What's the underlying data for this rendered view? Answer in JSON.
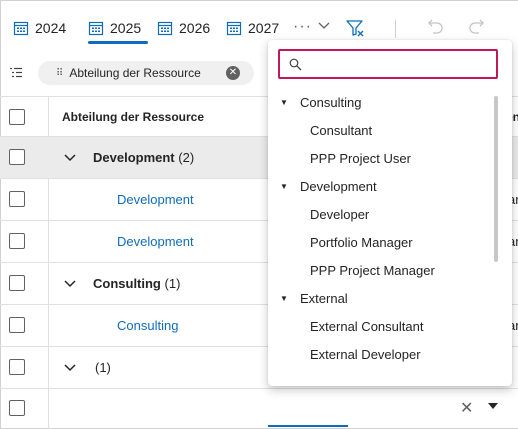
{
  "toolbar": {
    "years": [
      "2024",
      "2025",
      "2026",
      "2027"
    ],
    "active_year": "2025",
    "more_label": "···"
  },
  "groupby": {
    "chip_label": "Abteilung der Ressource",
    "remove_glyph": "✕"
  },
  "grid": {
    "column_header": "Abteilung der Ressource",
    "truncated_header": "en",
    "groups": [
      {
        "label": "Development",
        "count": "(2)",
        "items": [
          "Development",
          "Development"
        ]
      },
      {
        "label": "Consulting",
        "count": "(1)",
        "items": [
          "Consulting"
        ]
      },
      {
        "label": "",
        "count": "(1)",
        "items": []
      }
    ],
    "truncated_cell": "ar"
  },
  "dropdown": {
    "search_placeholder": "",
    "search_value": "",
    "options": [
      {
        "type": "group",
        "label": "Consulting"
      },
      {
        "type": "item",
        "label": "Consultant"
      },
      {
        "type": "item",
        "label": "PPP Project User"
      },
      {
        "type": "group",
        "label": "Development"
      },
      {
        "type": "item",
        "label": "Developer"
      },
      {
        "type": "item",
        "label": "Portfolio Manager"
      },
      {
        "type": "item",
        "label": "PPP Project Manager"
      },
      {
        "type": "group",
        "label": "External"
      },
      {
        "type": "item",
        "label": "External Consultant"
      },
      {
        "type": "item",
        "label": "External Developer"
      }
    ]
  },
  "colors": {
    "accent": "#0f6cbd",
    "search_focus": "#c2185b",
    "selected_row": "#ebebeb"
  }
}
